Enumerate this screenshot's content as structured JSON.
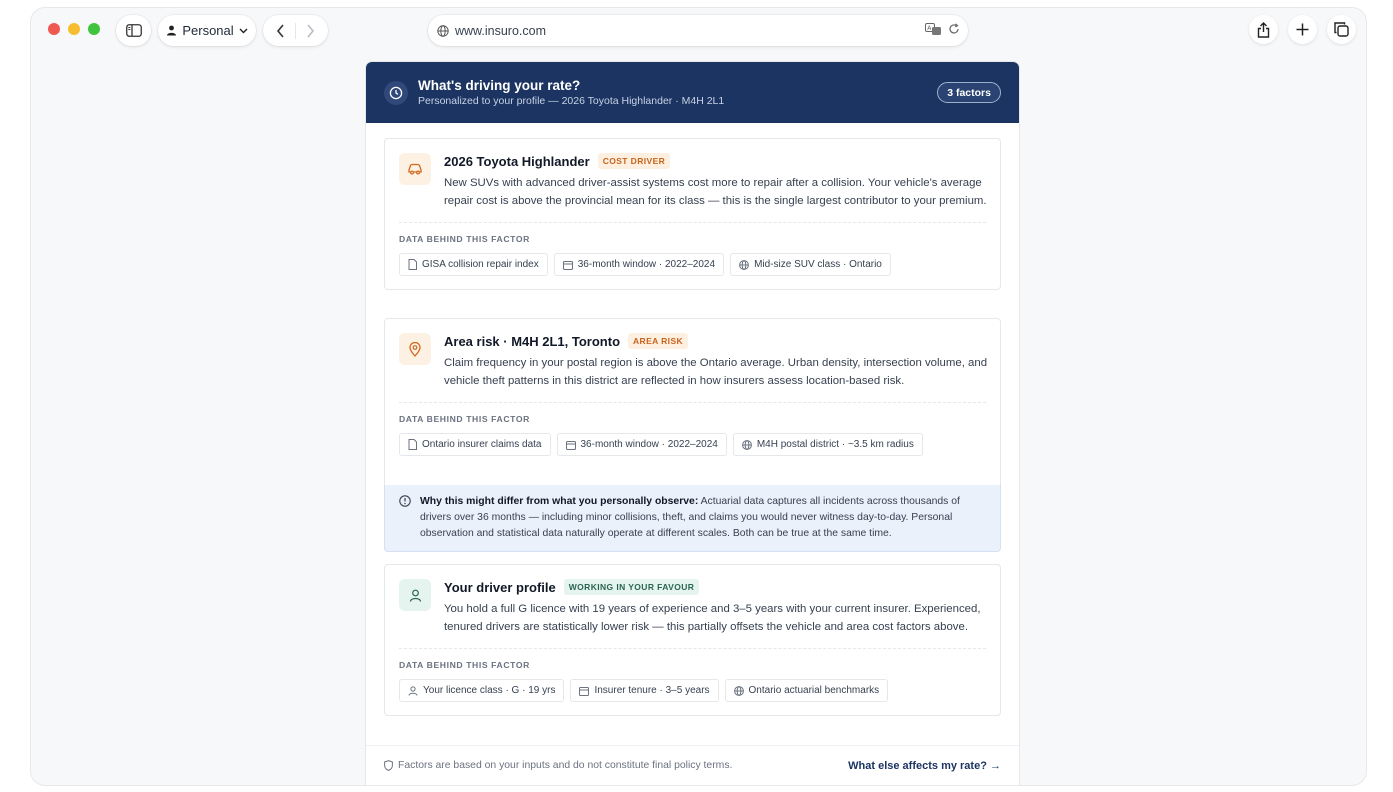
{
  "browser": {
    "profile": "Personal",
    "url": "www.insuro.com"
  },
  "header": {
    "title": "What's driving your rate?",
    "subtitle": "Personalized to your profile — 2026 Toyota Highlander · M4H 2L1",
    "badge": "3 factors"
  },
  "data_label": "DATA BEHIND THIS FACTOR",
  "factors": [
    {
      "title": "2026 Toyota Highlander",
      "tag": "COST DRIVER",
      "icon": "car-icon",
      "description": "New SUVs with advanced driver-assist systems cost more to repair after a collision. Your vehicle's average repair cost is above the provincial mean for its class — this is the single largest contributor to your premium.",
      "chips": [
        {
          "icon": "document-icon",
          "label": "GISA collision repair index"
        },
        {
          "icon": "calendar-icon",
          "label": "36-month window · 2022–2024"
        },
        {
          "icon": "globe-icon",
          "label": "Mid-size SUV class · Ontario"
        }
      ]
    },
    {
      "title": "Area risk · M4H 2L1, Toronto",
      "tag": "AREA RISK",
      "icon": "map-pin-icon",
      "description": "Claim frequency in your postal region is above the Ontario average. Urban density, intersection volume, and vehicle theft patterns in this district are reflected in how insurers assess location-based risk.",
      "chips": [
        {
          "icon": "document-icon",
          "label": "Ontario insurer claims data"
        },
        {
          "icon": "calendar-icon",
          "label": "36-month window · 2022–2024"
        },
        {
          "icon": "globe-icon",
          "label": "M4H postal district · ~3.5 km radius"
        }
      ]
    },
    {
      "title": "Your driver profile",
      "tag": "WORKING IN YOUR FAVOUR",
      "icon": "user-icon",
      "description": "You hold a full G licence with 19 years of experience and 3–5 years with your current insurer. Experienced, tenured drivers are statistically lower risk — this partially offsets the vehicle and area cost factors above.",
      "chips": [
        {
          "icon": "user-icon",
          "label": "Your licence class · G · 19 yrs"
        },
        {
          "icon": "calendar-icon",
          "label": "Insurer tenure · 3–5 years"
        },
        {
          "icon": "globe-icon",
          "label": "Ontario actuarial benchmarks"
        }
      ]
    }
  ],
  "note": {
    "lead": "Why this might differ from what you personally observe:",
    "text": " Actuarial data captures all incidents across thousands of drivers over 36 months — including minor collisions, theft, and claims you would never witness day-to-day. Personal observation and statistical data naturally operate at different scales. Both can be true at the same time."
  },
  "footer": {
    "disclaimer": "Factors are based on your inputs and do not constitute final policy terms.",
    "link": "What else affects my rate? →"
  },
  "colors": {
    "header_bg": "#1c3461",
    "cost_tag": "#c8631b",
    "favour_tag": "#28654f",
    "note_bg": "#ebf1fb"
  }
}
